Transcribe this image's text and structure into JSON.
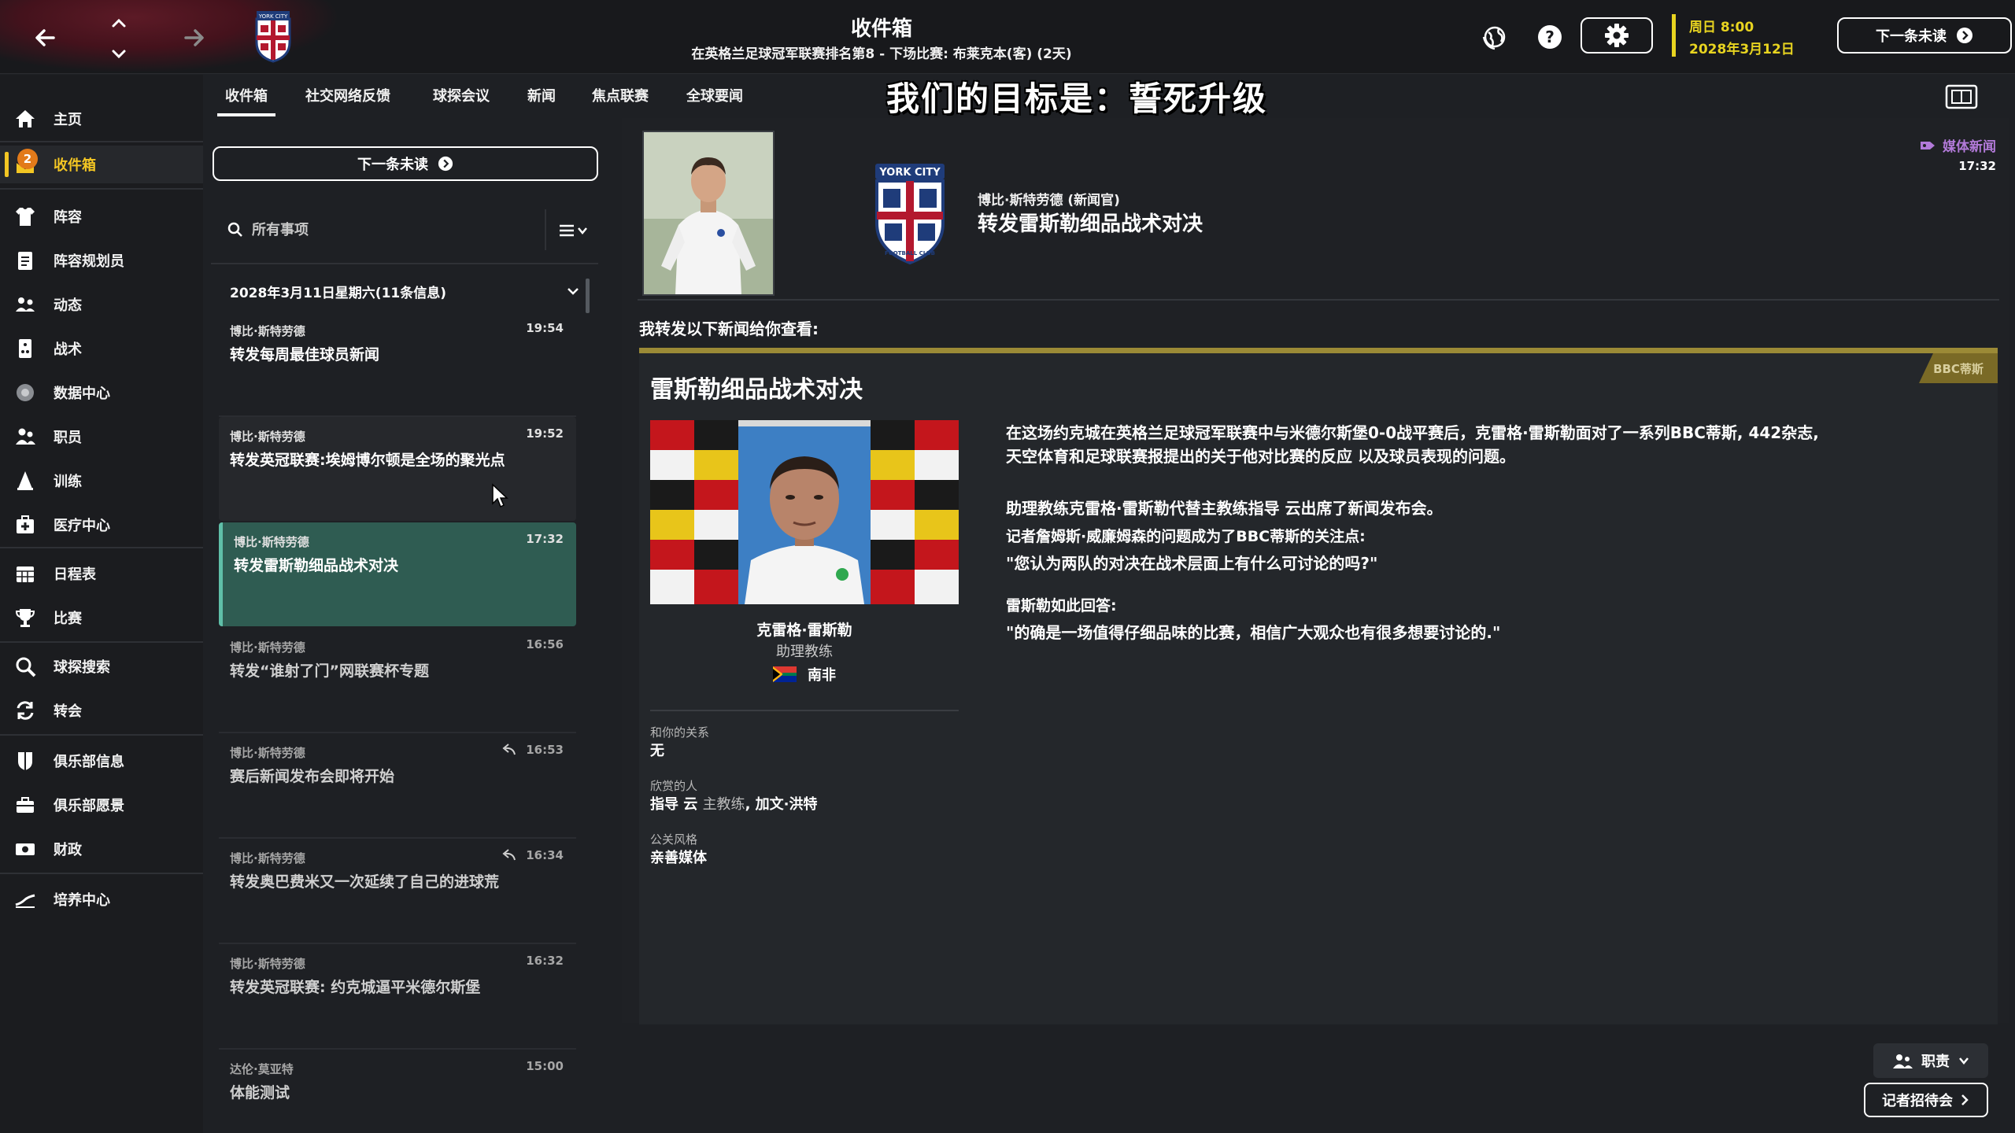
{
  "topbar": {
    "title": "收件箱",
    "subtitle": "在英格兰足球冠军联赛排名第8 - 下场比赛: 布莱克本(客) (2天)",
    "date_day": "周日 8:00",
    "date_full": "2028年3月12日",
    "next_unread_label": "下一条未读",
    "crest_text_top": "YORK CITY"
  },
  "sidebar": {
    "items": [
      {
        "label": "主页",
        "icon": "home-icon"
      },
      {
        "label": "收件箱",
        "icon": "inbox-icon",
        "badge": "2"
      },
      {
        "label": "阵容",
        "icon": "squad-icon"
      },
      {
        "label": "阵容规划员",
        "icon": "planner-icon"
      },
      {
        "label": "动态",
        "icon": "dynamics-icon"
      },
      {
        "label": "战术",
        "icon": "tactics-icon"
      },
      {
        "label": "数据中心",
        "icon": "data-hub-icon"
      },
      {
        "label": "职员",
        "icon": "staff-icon"
      },
      {
        "label": "训练",
        "icon": "training-icon"
      },
      {
        "label": "医疗中心",
        "icon": "medical-icon"
      },
      {
        "label": "日程表",
        "icon": "calendar-icon"
      },
      {
        "label": "比赛",
        "icon": "trophy-icon"
      },
      {
        "label": "球探搜索",
        "icon": "scouting-icon"
      },
      {
        "label": "转会",
        "icon": "transfers-icon"
      },
      {
        "label": "俱乐部信息",
        "icon": "club-info-icon"
      },
      {
        "label": "俱乐部愿景",
        "icon": "club-vision-icon"
      },
      {
        "label": "财政",
        "icon": "finances-icon"
      },
      {
        "label": "培养中心",
        "icon": "development-icon"
      }
    ]
  },
  "tabs": [
    {
      "label": "收件箱"
    },
    {
      "label": "社交网络反馈"
    },
    {
      "label": "球探会议"
    },
    {
      "label": "新闻"
    },
    {
      "label": "焦点联赛"
    },
    {
      "label": "全球要闻"
    }
  ],
  "banner_text": "我们的目标是：誓死升级",
  "list": {
    "next_unread_label": "下一条未读",
    "search_placeholder": "所有事项",
    "group_header": "2028年3月11日星期六(11条信息)",
    "messages": [
      {
        "sender": "博比·斯特劳德",
        "time": "19:54",
        "subject": "转发每周最佳球员新闻",
        "state": "unread"
      },
      {
        "sender": "博比·斯特劳德",
        "time": "19:52",
        "subject": "转发英冠联赛:埃姆博尔顿是全场的聚光点",
        "state": "hover"
      },
      {
        "sender": "博比·斯特劳德",
        "time": "17:32",
        "subject": "转发雷斯勒细品战术对决",
        "state": "active"
      },
      {
        "sender": "博比·斯特劳德",
        "time": "16:56",
        "subject": "转发“谁射了门”网联赛杯专题",
        "state": "read"
      },
      {
        "sender": "博比·斯特劳德",
        "time": "16:53",
        "subject": "赛后新闻发布会即将开始",
        "state": "read",
        "replied": true
      },
      {
        "sender": "博比·斯特劳德",
        "time": "16:34",
        "subject": "转发奥巴费米又一次延续了自己的进球荒",
        "state": "read",
        "replied": true
      },
      {
        "sender": "博比·斯特劳德",
        "time": "16:32",
        "subject": "转发英冠联赛: 约克城逼平米德尔斯堡",
        "state": "read"
      },
      {
        "sender": "达伦·莫亚特",
        "time": "15:00",
        "subject": "体能测试",
        "state": "read"
      }
    ]
  },
  "detail": {
    "from": "博比·斯特劳德 (新闻官)",
    "title": "转发雷斯勒细品战术对决",
    "media_tag": "媒体新闻",
    "time": "17:32",
    "crest_text": "YORK CITY",
    "crest_bottom": "FOOTBALL CLUB",
    "forward_intro": "我转发以下新闻给你查看:",
    "news_source": "BBC蒂斯",
    "news_headline": "雷斯勒细品战术对决",
    "coach": {
      "name": "克雷格·雷斯勒",
      "role": "助理教练",
      "nation": "南非"
    },
    "info": {
      "relation_label": "和你的关系",
      "relation_value": "无",
      "admired_label": "欣赏的人",
      "admired_name1": "指导 云",
      "admired_role1": "主教练",
      "admired_name2": "加文·洪特",
      "pr_label": "公关风格",
      "pr_value": "亲善媒体"
    },
    "article": {
      "p1_line1": "在这场约克城在英格兰足球冠军联赛中与米德尔斯堡0-0战平赛后，克雷格·雷斯勒面对了一系列BBC蒂斯, 442杂志,",
      "p1_line2": "天空体育和足球联赛报提出的关于他对比赛的反应 以及球员表现的问题。",
      "p2": "助理教练克雷格·雷斯勒代替主教练指导 云出席了新闻发布会。",
      "p3_line1": "记者詹姆斯·威廉姆森的问题成为了BBC蒂斯的关注点:",
      "p3_line2": "\"您认为两队的对决在战术层面上有什么可讨论的吗?\"",
      "p4_line1": "雷斯勒如此回答:",
      "p4_line2": "\"的确是一场值得仔细品味的比赛，相信广大观众也有很多想要讨论的.\""
    }
  },
  "bottom": {
    "role_label": "职责",
    "presser_label": "记者招待会"
  },
  "colors": {
    "accent_yellow": "#f3c623",
    "selected_row": "#2f5c52",
    "media_tag": "#b27ad9",
    "news_accent": "#9b8a36"
  }
}
